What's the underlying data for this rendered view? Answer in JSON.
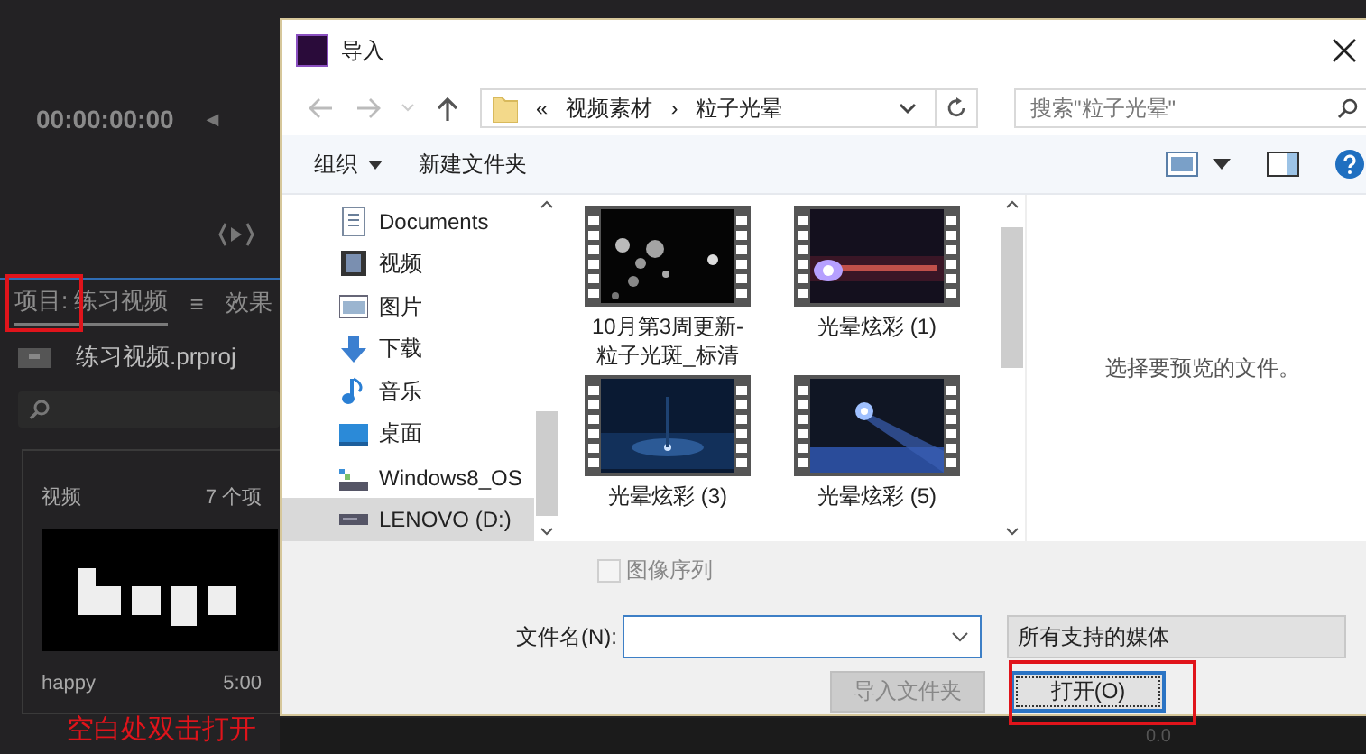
{
  "app": {
    "timecode": "00:00:00:00",
    "prev_glyph": "◀",
    "tabs": [
      {
        "label": "项目: 练习视频",
        "selected": true
      },
      {
        "label": "效果",
        "selected": false
      }
    ],
    "tab_menu": "≡",
    "project_file": "练习视频.prproj",
    "bin": {
      "name": "视频",
      "count": "7 个项"
    },
    "clip": {
      "name": "happy",
      "duration": "5:00",
      "kind": "picture"
    },
    "timeline_value": "0.0"
  },
  "annotation": {
    "text": "空白处双击打开"
  },
  "dialog": {
    "title": "导入",
    "address": {
      "overflow": "«",
      "crumbs": [
        "视频素材",
        "粒子光晕"
      ],
      "separator": "›"
    },
    "search": {
      "placeholder": "搜索\"粒子光晕\""
    },
    "toolbar": {
      "organize": "组织",
      "new_folder": "新建文件夹"
    },
    "nav_items": [
      {
        "label": "Documents",
        "kind": "document",
        "selected": false
      },
      {
        "label": "视频",
        "kind": "video",
        "selected": false
      },
      {
        "label": "图片",
        "kind": "pictures",
        "selected": false
      },
      {
        "label": "下载",
        "kind": "download",
        "selected": false
      },
      {
        "label": "音乐",
        "kind": "music",
        "selected": false
      },
      {
        "label": "桌面",
        "kind": "desktop",
        "selected": false
      },
      {
        "label": "Windows8_OS",
        "kind": "system-drive",
        "selected": false
      },
      {
        "label": "LENOVO (D:)",
        "kind": "drive",
        "selected": true
      }
    ],
    "files": [
      {
        "name": "10月第3周更新-粒子光斑_标清",
        "kind": "picture"
      },
      {
        "name": "光晕炫彩 (1)",
        "kind": "picture"
      },
      {
        "name": "光晕炫彩 (3)",
        "kind": "picture"
      },
      {
        "name": "光晕炫彩 (5)",
        "kind": "picture"
      }
    ],
    "preview_text": "选择要预览的文件。",
    "image_sequence": {
      "label": "图像序列",
      "checked": false,
      "disabled": true
    },
    "filename_label": "文件名(N):",
    "file_type": "所有支持的媒体",
    "buttons": [
      {
        "label": "导入文件夹",
        "disabled": true
      },
      {
        "label": "打开(O)",
        "disabled": false
      }
    ]
  }
}
